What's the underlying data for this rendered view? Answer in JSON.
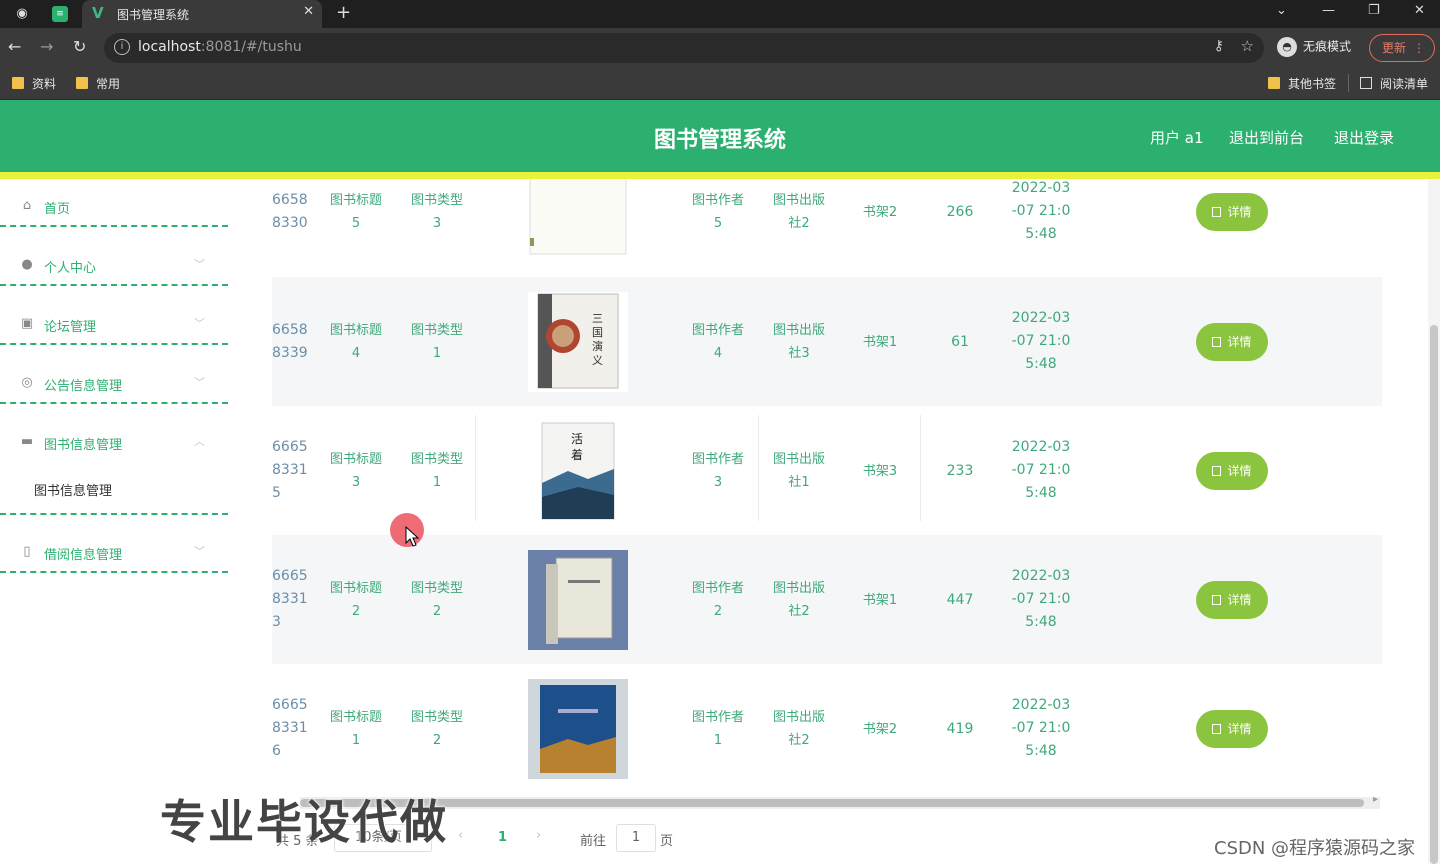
{
  "browser": {
    "tab_title": "图书管理系统",
    "url_host": "localhost",
    "url_path": ":8081/#/tushu",
    "incognito_label": "无痕模式",
    "update_label": "更新",
    "bookmarks": [
      "资料",
      "常用"
    ],
    "bookmarks_right": [
      "其他书签",
      "阅读清单"
    ]
  },
  "header": {
    "title": "图书管理系统",
    "user_label": "用户 a1",
    "back_label": "退出到前台",
    "logout_label": "退出登录"
  },
  "sidebar": {
    "items": [
      {
        "label": "首页",
        "icon": "home-icon"
      },
      {
        "label": "个人中心",
        "icon": "user-icon"
      },
      {
        "label": "论坛管理",
        "icon": "forum-icon"
      },
      {
        "label": "公告信息管理",
        "icon": "notice-icon"
      },
      {
        "label": "图书信息管理",
        "icon": "monitor-icon"
      },
      {
        "label": "借阅信息管理",
        "icon": "phone-icon"
      }
    ],
    "sub_item": "图书信息管理"
  },
  "table": {
    "detail_label": "详情",
    "rows": [
      {
        "id": "66588330",
        "title": "图书标题5",
        "type": "图书类型3",
        "author": "图书作者5",
        "publisher": "图书出版社2",
        "shelf": "书架2",
        "stock": "266",
        "date": "2022-03-07 21:05:48"
      },
      {
        "id": "66588339",
        "title": "图书标题4",
        "type": "图书类型1",
        "author": "图书作者4",
        "publisher": "图书出版社3",
        "shelf": "书架1",
        "stock": "61",
        "date": "2022-03-07 21:05:48"
      },
      {
        "id": "666583315",
        "title": "图书标题3",
        "type": "图书类型1",
        "author": "图书作者3",
        "publisher": "图书出版社1",
        "shelf": "书架3",
        "stock": "233",
        "date": "2022-03-07 21:05:48"
      },
      {
        "id": "666583313",
        "title": "图书标题2",
        "type": "图书类型2",
        "author": "图书作者2",
        "publisher": "图书出版社2",
        "shelf": "书架1",
        "stock": "447",
        "date": "2022-03-07 21:05:48"
      },
      {
        "id": "666583316",
        "title": "图书标题1",
        "type": "图书类型2",
        "author": "图书作者1",
        "publisher": "图书出版社2",
        "shelf": "书架2",
        "stock": "419",
        "date": "2022-03-07 21:05:48"
      }
    ]
  },
  "pagination": {
    "total": "共 5 条",
    "page_size": "10条/页",
    "current_page": "1",
    "goto_label": "前往",
    "goto_value": "1",
    "page_unit": "页"
  },
  "overlay": {
    "watermark": "专业毕设代做",
    "csdn": "CSDN @程序猿源码之家"
  },
  "colors": {
    "primary": "#2cb06f",
    "accent_bar": "#e8f23a",
    "detail_button": "#8bc53f"
  }
}
